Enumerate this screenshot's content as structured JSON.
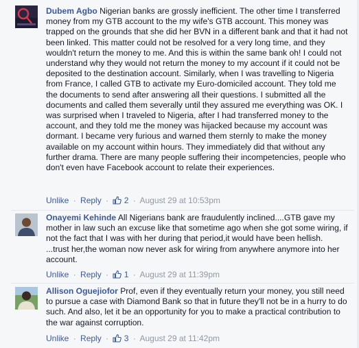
{
  "comments": [
    {
      "author": "Dubem Agbo",
      "text": "Nigerian banks are grossly inefficient. The other time I transferred money from my GTB account to the my wife's GTB account. This money was trapped on the grounds that she did her BVN in a different bank and that it had not been linked. This matter could not be resolved for a very long time, and they wouldn't return the money to me. And this is within the same bank oh! I could not understand why they would not return the money to my account if it could not be deposited to the destination account. Similarly, when I was travelling to Nigeria from France, I called GTB to activate my Euro-domiciled account. They told me the documents to send after answering all their questions. I submitted all the documents and called them severally until they assured me everything was OK. I was surprised when I traveled to Nigeria, after I had transferred money to the account, and they told me the money was hijacked because my account was dormant. I became very furious and warned them sternly to make the money available on my account within hours. They immediately did that without any further drama. There are many people suffering their incompetencies, people who don't even have Facebook account to relate their experiences.",
      "unlike_label": "Unlike",
      "reply_label": "Reply",
      "like_count": "2",
      "timestamp": "August 29 at 10:53pm"
    },
    {
      "author": "Onayemi Kehinde",
      "text": "All Nigerians bank are fraudulently inclined....GTB gave my mother in law such an excuse like that sometime ago when she got some wiring, if not the fact that I was with her during that period,it would have been hellish. ...trust her,the woman now never ask for wiring from anywhere anymore into her account.",
      "unlike_label": "Unlike",
      "reply_label": "Reply",
      "like_count": "1",
      "timestamp": "August 29 at 11:39pm"
    },
    {
      "author": "Allison Oguejiofor",
      "text": "Prof, even if they eventually return your money, you still need to pursue a case with Diamond Bank so that in future they'll not be in a hurry to do such. And also, let it be an opportunity for you to make a practical contribution to the war against corruption.",
      "unlike_label": "Unlike",
      "reply_label": "Reply",
      "like_count": "3",
      "timestamp": "August 29 at 11:42pm"
    }
  ],
  "separator": "·",
  "colors": {
    "link": "#3b5998",
    "meta": "#9197a3",
    "text": "#141823",
    "background": "#f6f7f9"
  },
  "icons": {
    "like": "thumbs-up-icon"
  }
}
